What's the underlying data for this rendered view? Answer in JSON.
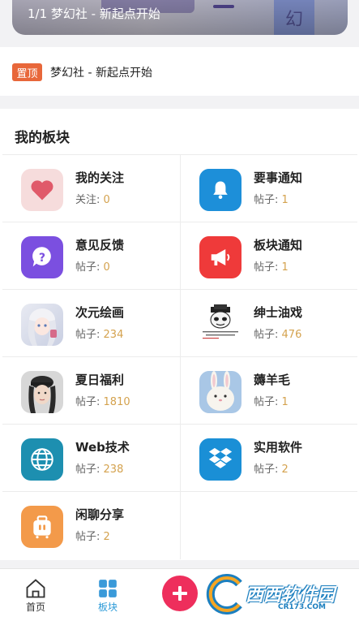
{
  "banner": {
    "caption": "1/1 梦幻社 - 新起点开始"
  },
  "pinned": {
    "badge": "置顶",
    "text": "梦幻社 - 新起点开始"
  },
  "section": {
    "title": "我的板块",
    "boards": [
      {
        "name": "我的关注",
        "meta_label": "关注:",
        "count": "0",
        "icon": "heart-icon"
      },
      {
        "name": "要事通知",
        "meta_label": "帖子:",
        "count": "1",
        "icon": "bell-icon"
      },
      {
        "name": "意见反馈",
        "meta_label": "帖子:",
        "count": "0",
        "icon": "question-bubble-icon"
      },
      {
        "name": "板块通知",
        "meta_label": "帖子:",
        "count": "1",
        "icon": "megaphone-icon"
      },
      {
        "name": "次元绘画",
        "meta_label": "帖子:",
        "count": "234",
        "icon": "anime-girl-avatar"
      },
      {
        "name": "绅士油戏",
        "meta_label": "帖子:",
        "count": "476",
        "icon": "panda-meme-avatar"
      },
      {
        "name": "夏日福利",
        "meta_label": "帖子:",
        "count": "1810",
        "icon": "girl-cap-avatar"
      },
      {
        "name": "薅羊毛",
        "meta_label": "帖子:",
        "count": "1",
        "icon": "rabbit-avatar"
      },
      {
        "name": "Web技术",
        "meta_label": "帖子:",
        "count": "238",
        "icon": "globe-icon"
      },
      {
        "name": "实用软件",
        "meta_label": "帖子:",
        "count": "2",
        "icon": "dropbox-icon"
      },
      {
        "name": "闲聊分享",
        "meta_label": "帖子:",
        "count": "2",
        "icon": "suitcase-icon"
      }
    ]
  },
  "nav": {
    "home": "首页",
    "boards": "板块",
    "watermark": "西西软件园",
    "watermark_sub": "CR173.COM"
  },
  "colors": {
    "accent": "#2e9bd8",
    "pin": "#e8673a",
    "count": "#d4a24e",
    "fab": "#ee2e5c"
  }
}
